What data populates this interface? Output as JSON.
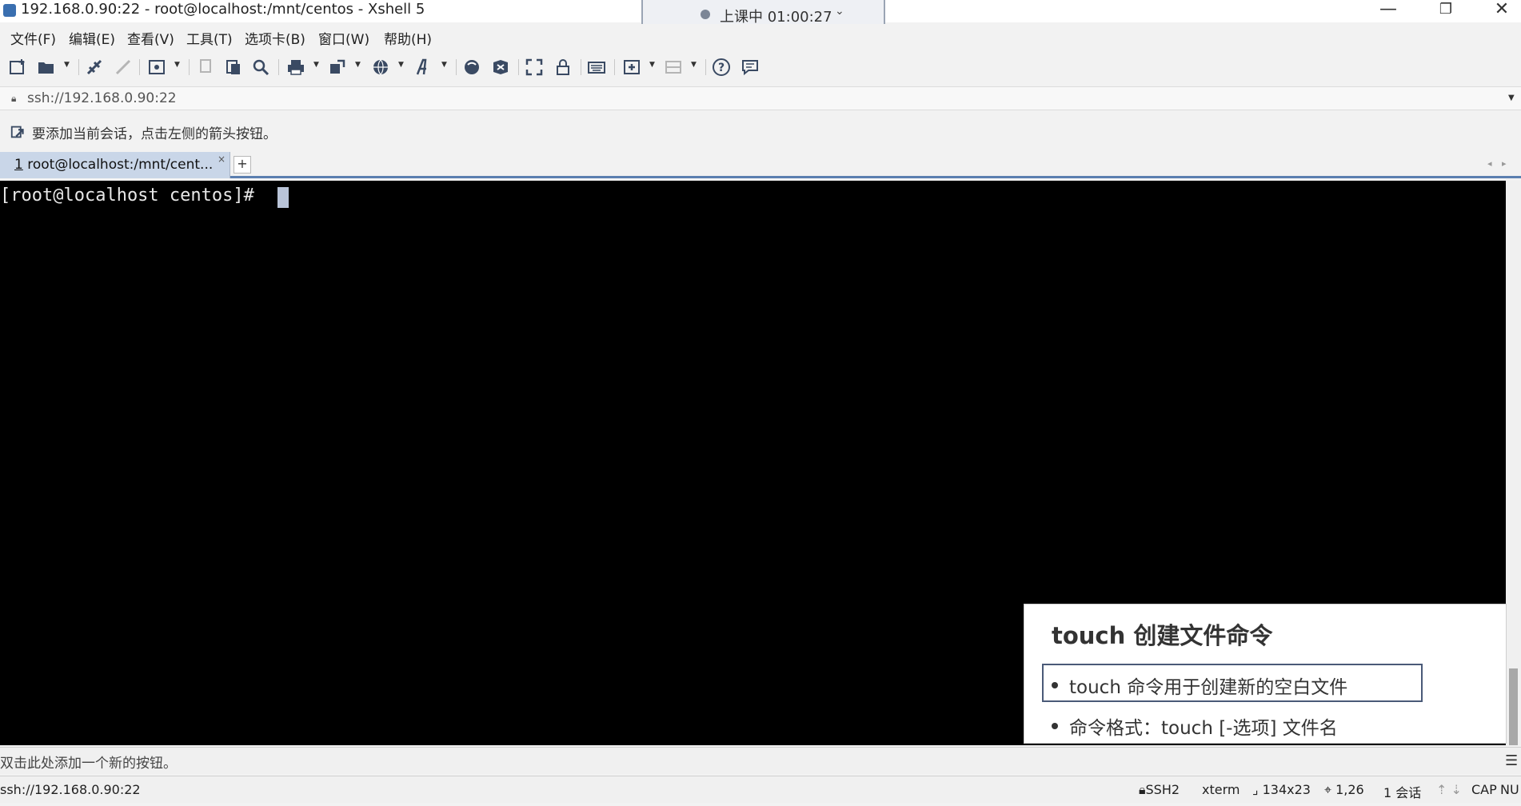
{
  "window": {
    "title": "192.168.0.90:22 - root@localhost:/mnt/centos - Xshell 5",
    "minimize": "—",
    "maximize": "❐",
    "close": "✕"
  },
  "recording": {
    "text": "上课中 01:00:27",
    "chevron": "⌄"
  },
  "menu": {
    "items": [
      "文件(F)",
      "编辑(E)",
      "查看(V)",
      "工具(T)",
      "选项卡(B)",
      "窗口(W)",
      "帮助(H)"
    ]
  },
  "toolbar": {
    "icons": [
      "new-session-icon",
      "open-folder-icon",
      "reconnect-icon",
      "disconnect-icon",
      "properties-icon",
      "copy-icon",
      "paste-icon",
      "find-icon",
      "print-icon",
      "transfer-icon",
      "globe-icon",
      "font-icon",
      "xftp-icon",
      "xmanager-icon",
      "fullscreen-icon",
      "lock-icon",
      "keyboard-icon",
      "compose-icon",
      "layout-icon",
      "help-icon",
      "chat-icon"
    ]
  },
  "address": {
    "value": "ssh://192.168.0.90:22"
  },
  "hint": {
    "text": "要添加当前会话，点击左侧的箭头按钮。"
  },
  "tabs": [
    {
      "index": "1",
      "label": "root@localhost:/mnt/cent...",
      "close": "×"
    }
  ],
  "tab_add": "+",
  "tab_nav": {
    "prev": "◂",
    "next": "▸"
  },
  "terminal": {
    "prompt": "[root@localhost centos]# "
  },
  "slide": {
    "title": "touch 创建文件命令",
    "bullets": [
      "touch 命令用于创建新的空白文件",
      "命令格式：touch [-选项] 文件名"
    ]
  },
  "quickbar": {
    "text": "双击此处添加一个新的按钮。"
  },
  "status": {
    "address": "ssh://192.168.0.90:22",
    "protocol": "SSH2",
    "terminal_type": "xterm",
    "size": "134x23",
    "cursor_pos": "1,26",
    "sessions": "1 会话",
    "caps": "CAP",
    "num": "NU"
  }
}
